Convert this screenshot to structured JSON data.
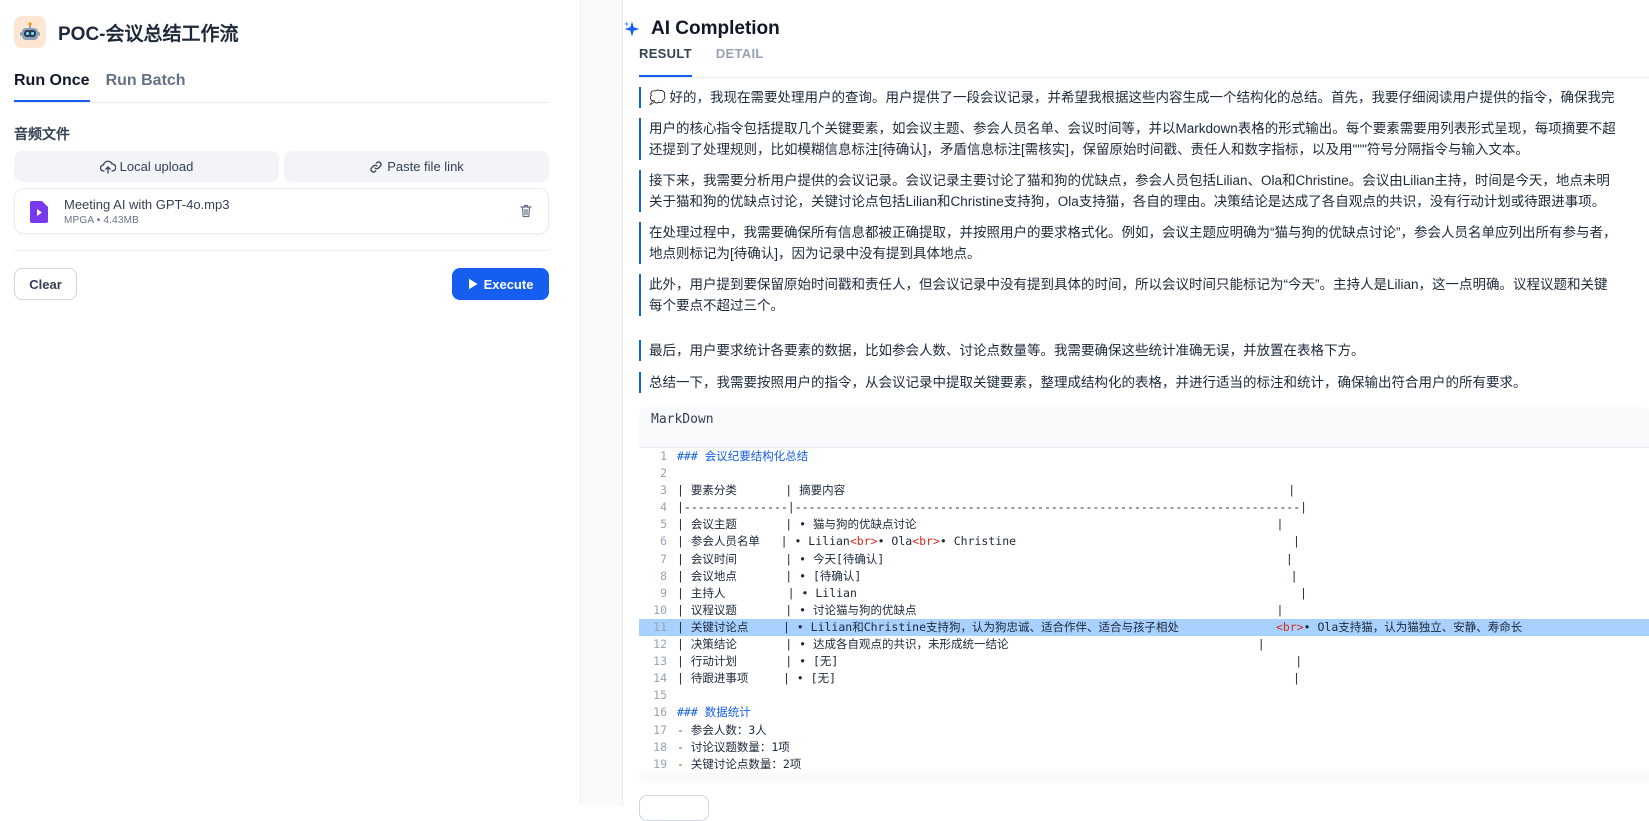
{
  "app": {
    "title": "POC-会议总结工作流",
    "icon": "robot-icon"
  },
  "tabs": [
    {
      "label": "Run Once",
      "active": true
    },
    {
      "label": "Run Batch",
      "active": false
    }
  ],
  "form": {
    "field_label": "音频文件",
    "local_upload": "Local upload",
    "paste_link": "Paste file link",
    "file": {
      "name": "Meeting AI with GPT-4o.mp3",
      "type": "MPGA",
      "size": "4.43MB",
      "sep": "•"
    },
    "clear_label": "Clear",
    "execute_label": "Execute"
  },
  "result_panel": {
    "title": "AI Completion",
    "tabs": [
      {
        "label": "RESULT",
        "active": true
      },
      {
        "label": "DETAIL",
        "active": false
      }
    ],
    "thinking": [
      "💭 好的，我现在需要处理用户的查询。用户提供了一段会议记录，并希望我根据这些内容生成一个结构化的总结。首先，我要仔细阅读用户提供的指令，确保我完",
      "用户的核心指令包括提取几个关键要素，如会议主题、参会人员名单、会议时间等，并以Markdown表格的形式输出。每个要素需要用列表形式呈现，每项摘要不超",
      "还提到了处理规则，比如模糊信息标注[待确认]，矛盾信息标注[需核实]，保留原始时间戳、责任人和数字指标，以及用\"\"\"符号分隔指令与输入文本。",
      "接下来，我需要分析用户提供的会议记录。会议记录主要讨论了猫和狗的优缺点，参会人员包括Lilian、Ola和Christine。会议由Lilian主持，时间是今天，地点未明",
      "关于猫和狗的优缺点讨论，关键讨论点包括Lilian和Christine支持狗，Ola支持猫，各自的理由。决策结论是达成了各自观点的共识，没有行动计划或待跟进事项。",
      "在处理过程中，我需要确保所有信息都被正确提取，并按照用户的要求格式化。例如，会议主题应明确为“猫与狗的优缺点讨论”，参会人员名单应列出所有参与者，",
      "地点则标记为[待确认]，因为记录中没有提到具体地点。",
      "此外，用户提到要保留原始时间戳和责任人，但会议记录中没有提到具体的时间，所以会议时间只能标记为“今天”。主持人是Lilian，这一点明确。议程议题和关键",
      "每个要点不超过三个。",
      "最后，用户要求统计各要素的数据，比如参会人数、讨论点数量等。我需要确保这些统计准确无误，并放置在表格下方。",
      "总结一下，我需要按照用户的指令，从会议记录中提取关键要素，整理成结构化的表格，并进行适当的标注和统计，确保输出符合用户的所有要求。"
    ],
    "markdown_label": "MarkDown",
    "code_lines": [
      "### 会议纪要结构化总结",
      "",
      "| 要素分类       | 摘要内容                                                                |",
      "|---------------|-------------------------------------------------------------------------|",
      "| 会议主题       | • 猫与狗的优缺点讨论                                                    |",
      "| 参会人员名单   | • Lilian<br>• Ola<br>• Christine                                        |",
      "| 会议时间       | • 今天[待确认]                                                          |",
      "| 会议地点       | • [待确认]                                                              |",
      "| 主持人         | • Lilian                                                                |",
      "| 议程议题       | • 讨论猫与狗的优缺点                                                    |",
      "| 关键讨论点     | • Lilian和Christine支持狗，认为狗忠诚、适合作伴、适合与孩子相处              <br>• Ola支持猫，认为猫独立、安静、寿命长",
      "| 决策结论       | • 达成各自观点的共识，未形成统一结论                                    |",
      "| 行动计划       | • [无]                                                                  |",
      "| 待跟进事项     | • [无]                                                                  |",
      "",
      "### 数据统计",
      "- 参会人数：3人",
      "- 讨论议题数量：1项",
      "- 关键讨论点数量：2项"
    ],
    "highlighted_line": 11
  },
  "colors": {
    "accent": "#155eef",
    "highlight": "#a8d1ff",
    "file_icon": "#7839ee"
  }
}
